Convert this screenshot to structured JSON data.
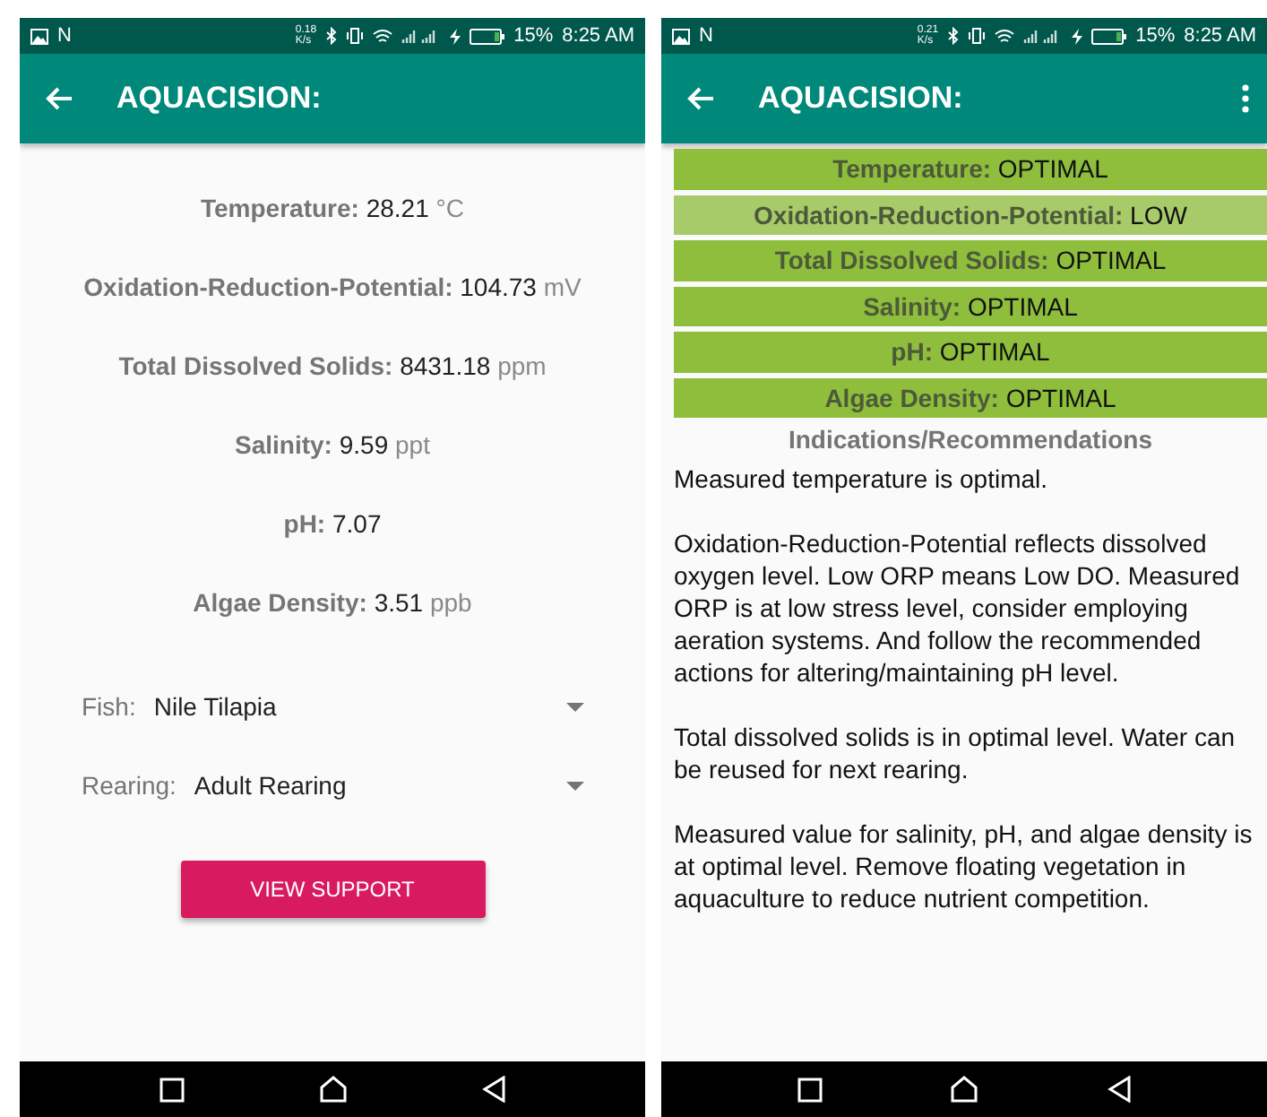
{
  "screens": [
    {
      "kind": "readings",
      "status_bar": {
        "carrier": "N",
        "speed": [
          "0.18",
          "K/s"
        ],
        "battery": "15%",
        "time": "8:25 AM"
      },
      "app_bar": {
        "title": "AQUACISION:",
        "overflow_menu": false
      },
      "readings": [
        {
          "label": "Temperature:",
          "value": "28.21",
          "unit": "°C"
        },
        {
          "label": "Oxidation-Reduction-Potential:",
          "value": "104.73",
          "unit": "mV"
        },
        {
          "label": "Total Dissolved Solids:",
          "value": "8431.18",
          "unit": "ppm"
        },
        {
          "label": "Salinity:",
          "value": "9.59",
          "unit": "ppt"
        },
        {
          "label": "pH:",
          "value": "7.07"
        },
        {
          "label": "Algae Density:",
          "value": "3.51",
          "unit": "ppb"
        }
      ],
      "selects": [
        {
          "label": "Fish:",
          "value": "Nile Tilapia"
        },
        {
          "label": "Rearing:",
          "value": "Adult Rearing"
        }
      ],
      "button": "VIEW SUPPORT"
    },
    {
      "kind": "results",
      "status_bar": {
        "carrier": "N",
        "speed": [
          "0.21",
          "K/s"
        ],
        "battery": "15%",
        "time": "8:25 AM"
      },
      "app_bar": {
        "title": "AQUACISION:",
        "overflow_menu": true
      },
      "statuses": [
        {
          "label": "Temperature:",
          "status": "OPTIMAL",
          "color": "#8fbe3c"
        },
        {
          "label": "Oxidation-Reduction-Potential:",
          "status": "LOW",
          "color": "#a8cb6a"
        },
        {
          "label": "Total Dissolved Solids:",
          "status": "OPTIMAL",
          "color": "#8fbe3c"
        },
        {
          "label": "Salinity:",
          "status": "OPTIMAL",
          "color": "#8fbe3c"
        },
        {
          "label": "pH:",
          "status": "OPTIMAL",
          "color": "#8fbe3c"
        },
        {
          "label": "Algae Density:",
          "status": "OPTIMAL",
          "color": "#8fbe3c"
        }
      ],
      "heading": "Indications/Recommendations",
      "paragraphs": [
        "Measured temperature is optimal.",
        "Oxidation-Reduction-Potential reflects dissolved oxygen level. Low ORP means Low DO. Measured ORP is at low stress level, consider employing aeration systems. And follow the recommended actions for altering/maintaining pH level.",
        "Total dissolved solids is in optimal level. Water can be reused for next rearing.",
        "Measured value for salinity, pH, and algae density is at optimal level. Remove floating vegetation in aquaculture to reduce nutrient competition."
      ]
    }
  ]
}
